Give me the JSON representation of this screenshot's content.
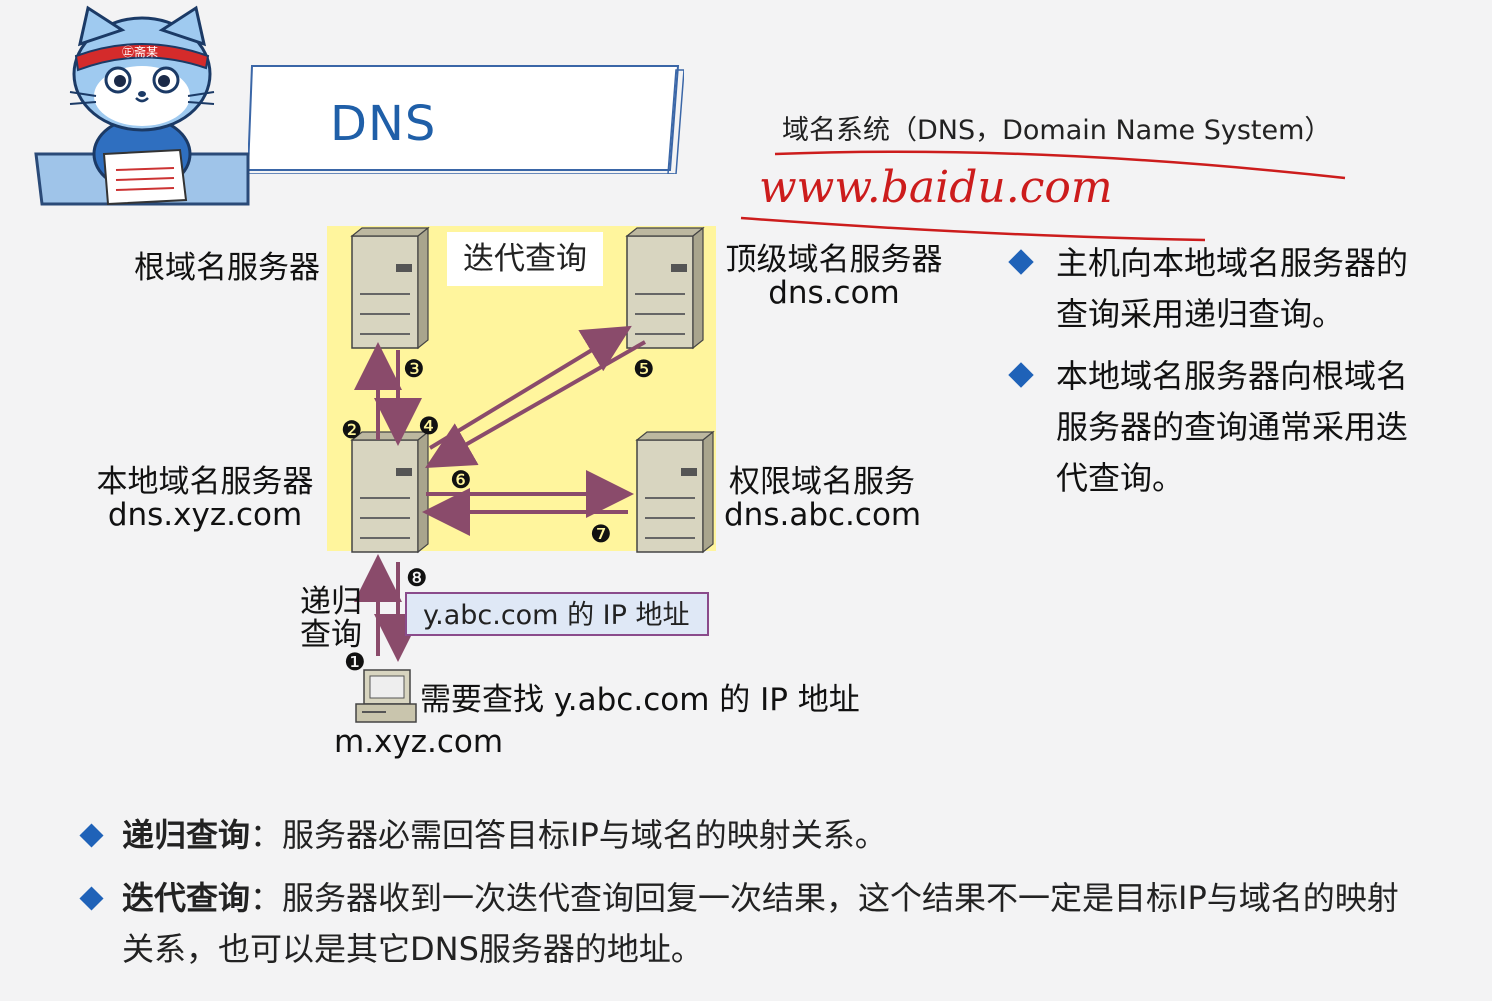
{
  "title": "DNS",
  "mascot": {
    "headband_text": "㊣斋某"
  },
  "definition": "域名系统（DNS，Domain Name System）",
  "handwriting": "www.baidu.com",
  "diagram": {
    "iterative_label": "迭代查询",
    "root_server": "根域名服务器",
    "tld_server": {
      "name": "顶级域名服务器",
      "domain": "dns.com"
    },
    "local_server": {
      "name": "本地域名服务器",
      "domain": "dns.xyz.com"
    },
    "auth_server": {
      "name": "权限域名服务",
      "domain": "dns.abc.com"
    },
    "recursive_label_line1": "递归",
    "recursive_label_line2": "查询",
    "answer": "y.abc.com 的 IP 地址",
    "host_query": "需要查找 y.abc.com 的 IP 地址",
    "host_domain": "m.xyz.com",
    "steps": [
      "❶",
      "❷",
      "❸",
      "❹",
      "❺",
      "❻",
      "❼",
      "❽"
    ]
  },
  "right_bullets": [
    {
      "line1": "主机向本地域名服务器的",
      "line2": "查询采用递归查询。"
    },
    {
      "line1": "本地域名服务器向根域名",
      "line2": "服务器的查询通常采用迭",
      "line3": "代查询。"
    }
  ],
  "bottom_bullets": [
    {
      "term": "递归查询",
      "sep": "：",
      "text": "服务器必需回答目标IP与域名的映射关系。"
    },
    {
      "term": "迭代查询",
      "sep": "：",
      "text": "服务器收到一次迭代查询回复一次结果，这个结果不一定是目标IP与域名的映射",
      "text2": "关系，也可以是其它DNS服务器的地址。"
    }
  ],
  "colors": {
    "accent": "#1f62b8",
    "title": "#1f5fa8",
    "yellow_panel": "#fff59d",
    "arrow": "#8a4b6b",
    "handwriting": "#cc1c1c"
  }
}
